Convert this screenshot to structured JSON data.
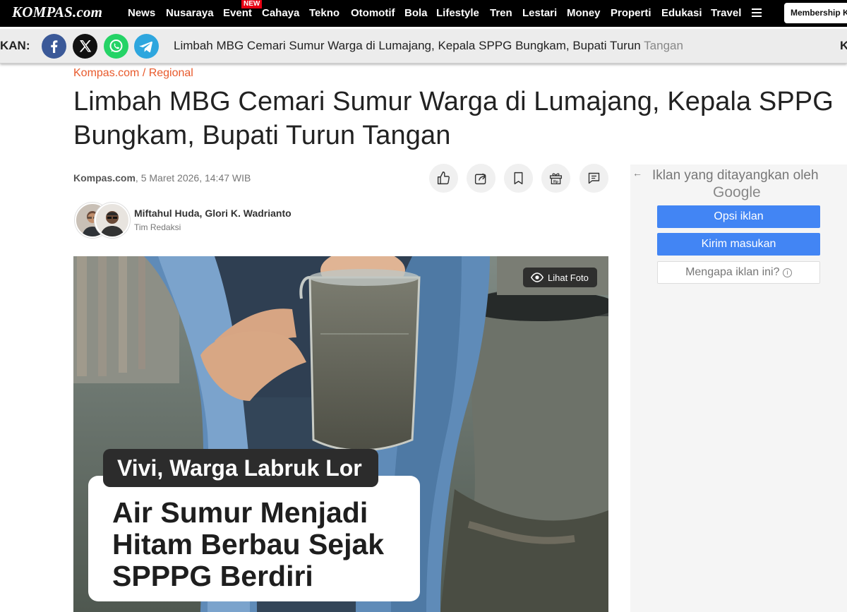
{
  "nav": {
    "logo": "KOMPAS.com",
    "items": [
      "News",
      "Nusaraya",
      "Event",
      "Cahaya",
      "Tekno",
      "Otomotif",
      "Bola",
      "Lifestyle",
      "Tren",
      "Lestari",
      "Money",
      "Properti",
      "Edukasi",
      "Travel"
    ],
    "new_badge": "NEW",
    "membership": "Membership K"
  },
  "sharebar": {
    "label": "KAN:",
    "ticker": "Limbah MBG Cemari Sumur Warga di Lumajang, Kepala SPPG Bungkam, Bupati Turun",
    "ticker_fade": "Tangan",
    "trailing": "K"
  },
  "article": {
    "breadcrumb": "Kompas.com / Regional",
    "title": "Limbah MBG Cemari Sumur Warga di Lumajang, Kepala SPPG Bungkam, Bupati Turun Tangan",
    "source": "Kompas.com",
    "date": ", 5 Maret 2026, 14:47 WIB",
    "authors": "Miftahul Huda,  Glori K. Wadrianto",
    "team": "Tim Redaksi",
    "photo": {
      "lihat_foto": "Lihat Foto",
      "caption_name": "Vivi, Warga Labruk Lor",
      "caption_line1": "Air Sumur Menjadi",
      "caption_line2": "Hitam Berbau Sejak",
      "caption_line3": "SPPPG Berdiri"
    }
  },
  "ad": {
    "title": "Iklan yang ditayangkan oleh",
    "brand": "Google",
    "btn_options": "Opsi iklan",
    "btn_feedback": "Kirim masukan",
    "btn_why": "Mengapa iklan ini?"
  }
}
